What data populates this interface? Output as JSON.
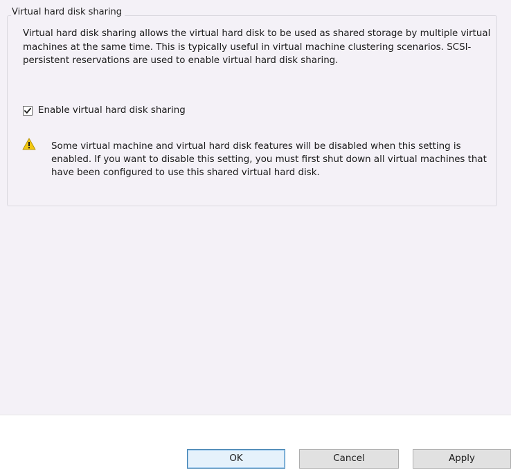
{
  "group": {
    "title": "Virtual hard disk sharing",
    "description": "Virtual hard disk sharing allows the virtual hard disk to be used as shared storage by multiple virtual machines at the same time. This is typically useful in virtual machine clustering scenarios. SCSI-persistent reservations are used to enable virtual hard disk sharing.",
    "checkbox": {
      "label": "Enable virtual hard disk sharing",
      "checked": true
    },
    "warning": {
      "icon": "warning-icon",
      "text": "Some virtual machine and virtual hard disk features will be disabled when this setting is enabled. If you want to disable this setting, you must first shut down all virtual machines that have been configured to use this shared virtual hard disk."
    }
  },
  "buttons": {
    "ok": "OK",
    "cancel": "Cancel",
    "apply": "Apply"
  },
  "colors": {
    "panel_background": "#f4f1f7",
    "default_button_border": "#3c7fb1",
    "warning_fill": "#f2c811"
  }
}
